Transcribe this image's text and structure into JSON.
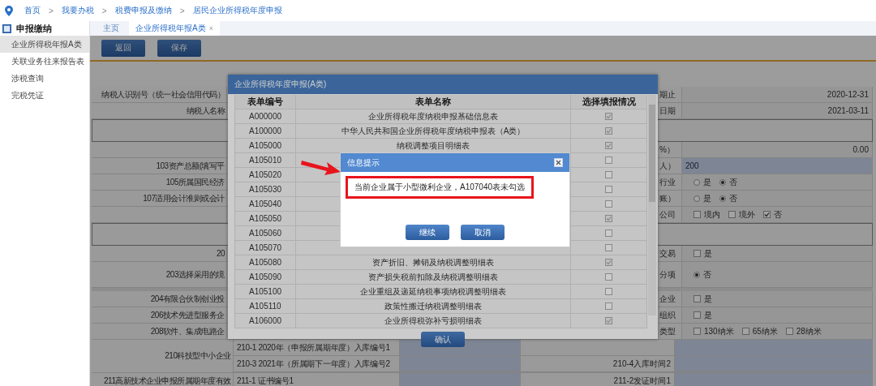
{
  "breadcrumb": {
    "separator": ">",
    "items": [
      "首页",
      "我要办税",
      "税费申报及缴纳",
      "居民企业所得税年度申报"
    ]
  },
  "sidebar": {
    "title": "申报缴纳",
    "items": [
      {
        "label": "企业所得税年报A类",
        "selected": true
      },
      {
        "label": "关联业务往来报告表",
        "selected": false
      },
      {
        "label": "涉税查询",
        "selected": false
      },
      {
        "label": "完税凭证",
        "selected": false
      }
    ]
  },
  "tabs": [
    {
      "label": "主页",
      "selected": false
    },
    {
      "label": "企业所得税年报A类",
      "selected": true,
      "close": "×"
    }
  ],
  "toolbar": [
    {
      "label": "返回"
    },
    {
      "label": "保存"
    }
  ],
  "form": {
    "rows": [
      {
        "kind": "text",
        "label": "纳税人识别号（统一社会信用代码）",
        "right_label": "期止",
        "value": "2020-12-31"
      },
      {
        "kind": "text",
        "label": "纳税人名称",
        "right_label": "日期",
        "value": "2021-03-11"
      },
      {
        "kind": "section"
      },
      {
        "kind": "text",
        "right_label": "%）",
        "value": "0.00"
      },
      {
        "kind": "input",
        "label": "103资产总额(填写平",
        "right_label": "人）",
        "value": "200"
      },
      {
        "kind": "choice",
        "label": "105所属国民经济",
        "right_label": "行业",
        "options": [
          {
            "kind": "radio",
            "label": "是",
            "checked": false
          },
          {
            "kind": "radio",
            "label": "否",
            "checked": true
          }
        ]
      },
      {
        "kind": "choice",
        "label": "107适用会计准则或会计",
        "right_label": "账）",
        "options": [
          {
            "kind": "radio",
            "label": "是",
            "checked": false
          },
          {
            "kind": "radio",
            "label": "否",
            "checked": true
          }
        ]
      },
      {
        "kind": "choice",
        "right_label": "公司",
        "options": [
          {
            "kind": "checkbox",
            "label": "境内",
            "checked": false
          },
          {
            "kind": "checkbox",
            "label": "境外",
            "checked": false
          },
          {
            "kind": "checkbox",
            "label": "否",
            "checked": true
          }
        ]
      },
      {
        "kind": "section"
      },
      {
        "kind": "choice",
        "label": "20",
        "right_label": "交易",
        "options": [
          {
            "kind": "checkbox",
            "label": "是",
            "checked": false
          }
        ]
      },
      {
        "kind": "choice",
        "tall": true,
        "label": "203选择采用的境",
        "right_label": "分项",
        "options": [
          {
            "kind": "radio",
            "label": "否",
            "checked": true
          }
        ]
      },
      {
        "kind": "gap"
      },
      {
        "kind": "choice",
        "label": "204有限合伙制创业投",
        "right_label": "企业",
        "options": [
          {
            "kind": "checkbox",
            "label": "是",
            "checked": false
          }
        ]
      },
      {
        "kind": "choice",
        "label": "206技术先进型服务企",
        "right_label": "组织",
        "options": [
          {
            "kind": "checkbox",
            "label": "是",
            "checked": false
          }
        ]
      },
      {
        "kind": "choice",
        "label": "208软件、集成电路企",
        "right_label": "类型",
        "options": [
          {
            "kind": "checkbox",
            "label": "130纳米",
            "checked": false
          },
          {
            "kind": "checkbox",
            "label": "65纳米",
            "checked": false
          },
          {
            "kind": "checkbox",
            "label": "28纳米",
            "checked": false
          }
        ]
      },
      {
        "kind": "multi",
        "label": "210科技型中小企业",
        "subrows": [
          {
            "left": "210-1 2020年（申报所属期年度）入库编号1"
          },
          {
            "left": "210-3 2021年（所属期下一年度）入库编号2",
            "right": "210-4入库时间2"
          }
        ]
      },
      {
        "kind": "multi",
        "label": "211高新技术企业申报所属期年度有效",
        "subrows": [
          {
            "left": "211-1 证书编号1",
            "right": "211-2发证时间1"
          }
        ]
      }
    ]
  },
  "dialog": {
    "title": "企业所得税年度申报(A类)",
    "columns": [
      "表单编号",
      "表单名称",
      "选择填报情况"
    ],
    "confirm": "确认",
    "forms": [
      {
        "code": "A000000",
        "name": "企业所得税年度纳税申报基础信息表",
        "checked": true
      },
      {
        "code": "A100000",
        "name": "中华人民共和国企业所得税年度纳税申报表（A类）",
        "checked": true
      },
      {
        "code": "A105000",
        "name": "纳税调整项目明细表",
        "checked": true
      },
      {
        "code": "A105010",
        "checked": false
      },
      {
        "code": "A105020",
        "checked": false
      },
      {
        "code": "A105030",
        "checked": false
      },
      {
        "code": "A105040",
        "checked": false
      },
      {
        "code": "A105050",
        "checked": true
      },
      {
        "code": "A105060",
        "checked": false
      },
      {
        "code": "A105070",
        "checked": false
      },
      {
        "code": "A105080",
        "name": "资产折旧、摊销及纳税调整明细表",
        "checked": true
      },
      {
        "code": "A105090",
        "name": "资产损失税前扣除及纳税调整明细表",
        "checked": false
      },
      {
        "code": "A105100",
        "name": "企业重组及递延纳税事项纳税调整明细表",
        "checked": false
      },
      {
        "code": "A105110",
        "name": "政策性搬迁纳税调整明细表",
        "checked": false
      },
      {
        "code": "A106000",
        "name": "企业所得税弥补亏损明细表",
        "checked": true
      }
    ]
  },
  "alert": {
    "title": "信息提示",
    "message": "当前企业属于小型微利企业，A107040表未勾选",
    "buttons": [
      "继续",
      "取消"
    ]
  }
}
